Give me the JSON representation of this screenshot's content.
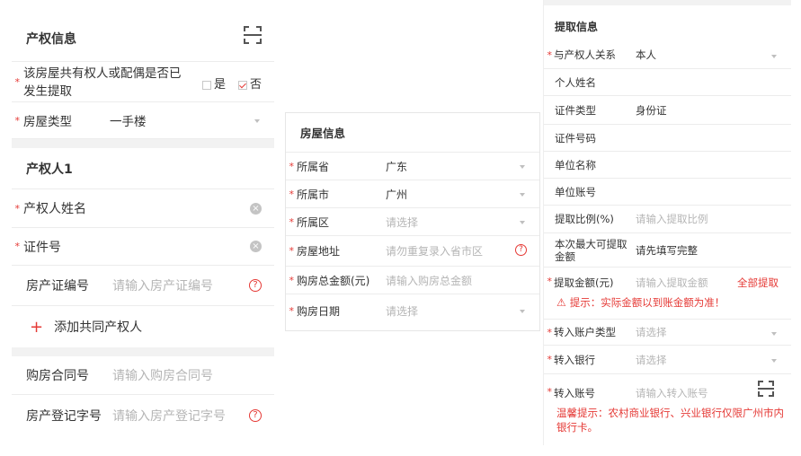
{
  "left": {
    "property_info": {
      "title": "产权信息",
      "joint_question": "该房屋共有权人或配偶是否已发生提取",
      "opt_yes": "是",
      "opt_no": "否",
      "house_type_label": "房屋类型",
      "house_type_value": "一手楼"
    },
    "owner1": {
      "title": "产权人1",
      "name_label": "产权人姓名",
      "id_label": "证件号",
      "cert_label": "房产证编号",
      "cert_placeholder": "请输入房产证编号",
      "add_owner": "添加共同产权人"
    },
    "contract": {
      "contract_label": "购房合同号",
      "contract_placeholder": "请输入购房合同号",
      "reg_label": "房产登记字号",
      "reg_placeholder": "请输入房产登记字号"
    }
  },
  "middle": {
    "title": "房屋信息",
    "province_label": "所属省",
    "province_value": "广东",
    "city_label": "所属市",
    "city_value": "广州",
    "district_label": "所属区",
    "district_placeholder": "请选择",
    "address_label": "房屋地址",
    "address_placeholder": "请勿重复录入省市区",
    "amount_label": "购房总金额(元)",
    "amount_placeholder": "请输入购房总金额",
    "date_label": "购房日期",
    "date_placeholder": "请选择"
  },
  "right": {
    "title": "提取信息",
    "relation_label": "与产权人关系",
    "relation_value": "本人",
    "name_label": "个人姓名",
    "idtype_label": "证件类型",
    "idtype_value": "身份证",
    "idno_label": "证件号码",
    "unit_name_label": "单位名称",
    "unit_acct_label": "单位账号",
    "ratio_label": "提取比例(%)",
    "ratio_placeholder": "请输入提取比例",
    "max_label": "本次最大可提取金额",
    "max_value": "请先填写完整",
    "amount_label": "提取金额(元)",
    "amount_placeholder": "请输入提取金额",
    "all_link": "全部提取",
    "warning": "提示：实际金额以到账金额为准！",
    "acct_type_label": "转入账户类型",
    "acct_type_placeholder": "请选择",
    "bank_label": "转入银行",
    "bank_placeholder": "请选择",
    "acct_no_label": "转入账号",
    "acct_no_placeholder": "请输入转入账号",
    "notice": "温馨提示：农村商业银行、兴业银行仅限广州市内银行卡。"
  },
  "colors": {
    "required": "#e53935",
    "placeholder": "#b5b5b5",
    "divider": "#f2f2f2"
  }
}
